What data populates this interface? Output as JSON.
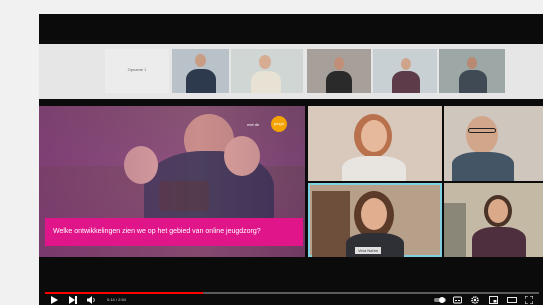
{
  "video": {
    "top_tile_label_1": "Opname 1",
    "top_tile_label_2": "",
    "slide_logo_prefix": "met de",
    "slide_logo_circle": "jeugd",
    "slide_question": "Welke ontwikkelingen zien we op het gebied van online jeugdzorg?",
    "speaker_name": "Vera Nahm",
    "current_time": "0:14 / 2:54",
    "progress_fraction": 0.32
  },
  "icons": {
    "play": "play-icon",
    "next": "next-icon",
    "volume": "volume-icon",
    "autoplay": "autoplay-toggle-icon",
    "subtitles": "subtitles-icon",
    "settings": "gear-icon",
    "miniplayer": "miniplayer-icon",
    "theater": "theater-icon",
    "fullscreen": "fullscreen-icon"
  },
  "colors": {
    "accent_pink": "#e0158a",
    "progress_red": "#ff0000",
    "speaker_highlight": "#7fd0e0"
  }
}
